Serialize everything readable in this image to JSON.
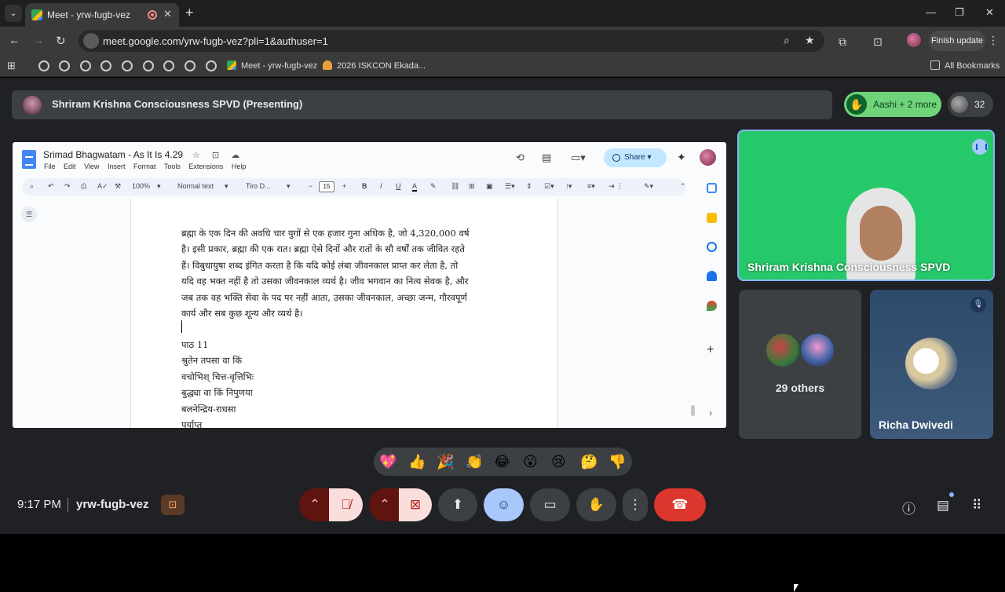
{
  "browser": {
    "tab_title": "Meet - yrw-fugb-vez",
    "url": "meet.google.com/yrw-fugb-vez?pli=1&authuser=1",
    "finish_update": "Finish update",
    "bookmarks": [
      {
        "label": "Meet - yrw-fugb-vez",
        "icon": "meet-icon"
      },
      {
        "label": "2026 ISKCON Ekada...",
        "icon": "iskcon-icon"
      }
    ],
    "all_bookmarks": "All Bookmarks"
  },
  "meet": {
    "presenting_label": "Shriram Krishna Consciousness SPVD (Presenting)",
    "raised_hands": "Aashi + 2 more",
    "participant_count": "32",
    "time": "9:17 PM",
    "meeting_code": "yrw-fugb-vez"
  },
  "docs": {
    "title": "Srimad Bhagwatam - As It Is 4.29",
    "menus": [
      "File",
      "Edit",
      "View",
      "Insert",
      "Format",
      "Tools",
      "Extensions",
      "Help"
    ],
    "share_label": "Share",
    "zoom": "100%",
    "style": "Normal text",
    "font": "Tiro D...",
    "font_size": "15",
    "paragraph_lines": [
      "ब्रह्मा के एक दिन की अवधि चार युगों से एक हजार गुना अधिक है, जो 4,320,000 वर्ष",
      "है। इसी प्रकार, ब्रह्मा की एक रात। ब्रह्मा ऐसे दिनों और रातों के सौ वर्षों तक जीवित रहते",
      "हैं। विबुधायुषा शब्द इंगित करता है कि यदि कोई लंबा जीवनकाल प्राप्त कर लेता है, तो",
      "यदि वह भक्त नहीं है तो उसका जीवनकाल व्यर्थ है। जीव भगवान का नित्य सेवक है, और",
      "जब तक वह भक्ति सेवा के पद पर नहीं आता, उसका जीवनकाल, अच्छा जन्म, गौरवपूर्ण",
      "कार्य और सब कुछ शून्य और व्यर्थ है।"
    ],
    "verse_lines": [
      "पाठ 11",
      "श्रुतेन तपसा वा किं",
      "वचोभिश् चित्त-वृत्तिभिः",
      "बुद्ध्या वा किं निपुणया",
      "बलनेन्द्रिय-राधसा",
      "पर्याप्त"
    ]
  },
  "tiles": {
    "main_name": "Shriram Krishna Consciousness SPVD",
    "others_label": "29 others",
    "richa_name": "Richa Dwivedi"
  },
  "reactions": [
    "💖",
    "👍",
    "🎉",
    "👏",
    "😂",
    "😮",
    "😢",
    "🤔",
    "👎"
  ],
  "colors": {
    "meet_bg": "#202124",
    "end_call": "#dc362e",
    "hand_pill": "#6fd37a",
    "speaker_border": "#8ab4f8"
  }
}
